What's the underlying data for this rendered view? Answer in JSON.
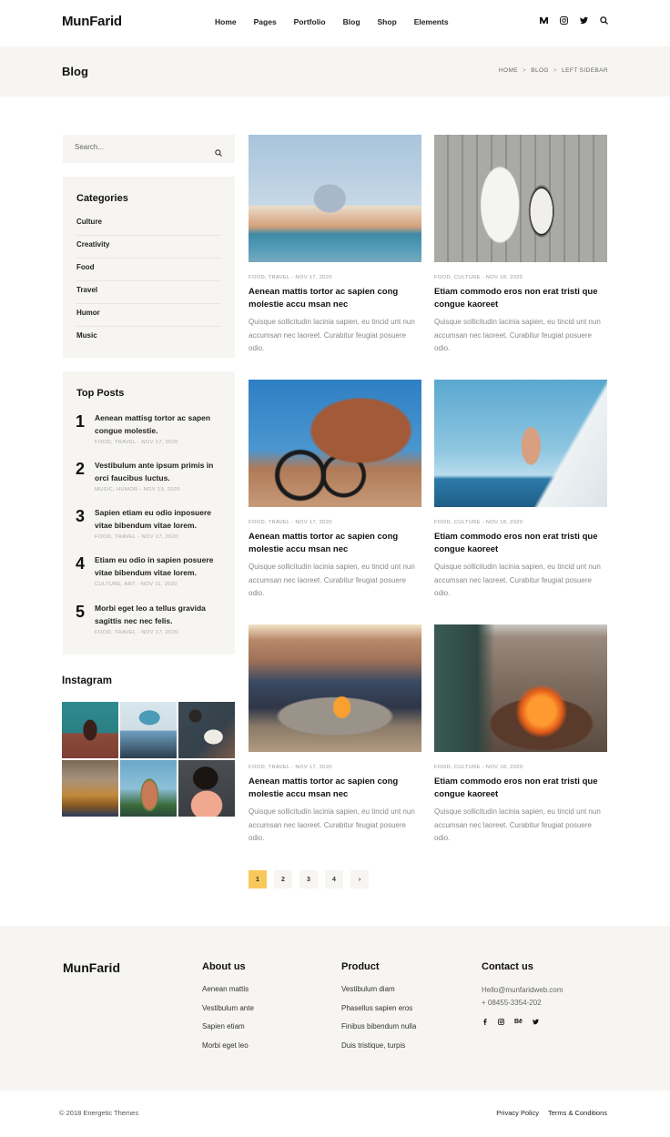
{
  "header": {
    "logo": "MunFarid",
    "nav": [
      "Home",
      "Pages",
      "Portfolio",
      "Blog",
      "Shop",
      "Elements"
    ],
    "icons": [
      "medium-icon",
      "instagram-icon",
      "twitter-icon",
      "search-icon"
    ]
  },
  "banner": {
    "title": "Blog",
    "breadcrumb": [
      "HOME",
      "BLOG",
      "LEFT SIDEBAR"
    ]
  },
  "sidebar": {
    "search_placeholder": "Search...",
    "categories": {
      "title": "Categories",
      "items": [
        "Culture",
        "Creativity",
        "Food",
        "Travel",
        "Humor",
        "Music"
      ]
    },
    "top_posts": {
      "title": "Top Posts",
      "items": [
        {
          "num": "1",
          "title": "Aenean mattisg tortor ac sapen congue molestie.",
          "meta": "FOOD, TRAVEL - NOV 17, 2020"
        },
        {
          "num": "2",
          "title": "Vestibulum ante ipsum primis in orci faucibus luctus.",
          "meta": "MUSIC, HUMOR - NOV 13, 2020"
        },
        {
          "num": "3",
          "title": "Sapien  etiam eu odio inposuere vitae bibendum vitae lorem.",
          "meta": "FOOD, TRAVEL - NOV 17, 2020"
        },
        {
          "num": "4",
          "title": "Etiam eu odio in sapien posuere vitae bibendum vitae lorem.",
          "meta": "CULTURE, ART - NOV 11, 2020"
        },
        {
          "num": "5",
          "title": "Morbi eget leo a tellus gravida sagittis nec nec felis.",
          "meta": "FOOD, TRAVEL - NOV 17, 2020"
        }
      ]
    },
    "instagram": {
      "title": "Instagram",
      "photos": [
        "woman-teal-background",
        "woman-blue-beanie",
        "reading-book-coffee",
        "restaurant-interior",
        "woman-palm-trees",
        "woman-curly-hair-sunglasses"
      ]
    }
  },
  "posts": [
    {
      "image": "venice-church",
      "meta": "FOOD, TRAVEL - NOV 17, 2020",
      "title": "Aenean mattis tortor ac sapien cong molestie accu msan nec",
      "excerpt": "Quisque sollicitudin lacinia sapien, eu tincid unt nun accumsan nec laoreet. Curabitur feugiat posuere odio."
    },
    {
      "image": "couple-holding-hands",
      "meta": "FOOD, CULTURE - NOV 18, 2020",
      "title": "Etiam commodo eros non erat tristi que congue kaoreet",
      "excerpt": "Quisque sollicitudin lacinia sapien, eu tincid unt nun accumsan nec laoreet. Curabitur feugiat posuere odio."
    },
    {
      "image": "mountain-biker-rocks",
      "meta": "FOOD, TRAVEL - NOV 17, 2020",
      "title": "Aenean mattis tortor ac sapien cong molestie accu msan nec",
      "excerpt": "Quisque sollicitudin lacinia sapien, eu tincid unt nun accumsan nec laoreet. Curabitur feugiat posuere odio."
    },
    {
      "image": "man-on-sailboat",
      "meta": "FOOD, CULTURE - NOV 18, 2020",
      "title": "Etiam commodo eros non erat tristi que congue kaoreet",
      "excerpt": "Quisque sollicitudin lacinia sapien, eu tincid unt nun accumsan nec laoreet. Curabitur feugiat posuere odio."
    },
    {
      "image": "campfire-group",
      "meta": "FOOD, TRAVEL - NOV 17, 2020",
      "title": "Aenean mattis tortor ac sapien cong molestie accu msan nec",
      "excerpt": "Quisque sollicitudin lacinia sapien, eu tincid unt nun accumsan nec laoreet. Curabitur feugiat posuere odio."
    },
    {
      "image": "beach-fire-pit",
      "meta": "FOOD, CULTURE - NOV 18, 2020",
      "title": "Etiam commodo eros non erat tristi que congue kaoreet",
      "excerpt": "Quisque sollicitudin lacinia sapien, eu tincid unt nun accumsan nec laoreet. Curabitur feugiat posuere odio."
    }
  ],
  "pagination": {
    "pages": [
      "1",
      "2",
      "3",
      "4"
    ],
    "current": "1",
    "next": "›"
  },
  "footer": {
    "logo": "MunFarid",
    "about": {
      "title": "About us",
      "links": [
        "Aenean mattis",
        "Vestibulum ante",
        "Sapien etiam",
        "Morbi eget leo"
      ]
    },
    "product": {
      "title": "Product",
      "links": [
        "Vestibulum diam",
        "Phasellus sapien eros",
        "Finibus bibendum nulla",
        "Duis tristique, turpis"
      ]
    },
    "contact": {
      "title": "Contact us",
      "email": "Hello@munfaridweb.com",
      "phone": "+ 08455-3354-202",
      "social": [
        "facebook-icon",
        "instagram-icon",
        "behance-icon",
        "twitter-icon"
      ],
      "behance_label": "Bē"
    },
    "copyright": "© 2018 Energetic Themes",
    "legal": [
      "Privacy Policy",
      "Terms & Conditions"
    ]
  },
  "colors": {
    "accent": "#f8c95a",
    "panel_bg": "#f6f5f2",
    "text_dark": "#111111",
    "text_muted": "#888888"
  }
}
